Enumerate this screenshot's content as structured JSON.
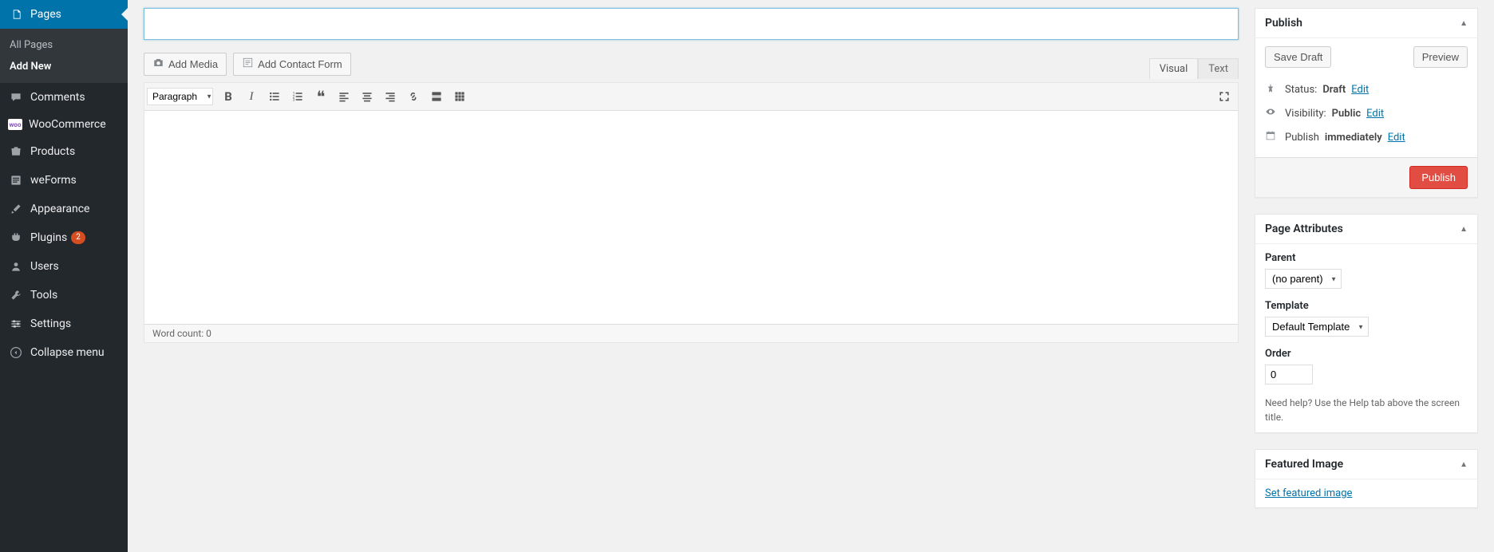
{
  "sidebar": {
    "items": [
      {
        "label": "Pages",
        "icon": "📄",
        "current": true,
        "submenu": [
          {
            "label": "All Pages"
          },
          {
            "label": "Add New",
            "current": true
          }
        ]
      },
      {
        "label": "Comments",
        "icon": "💬"
      },
      {
        "label": "WooCommerce",
        "icon": "woo"
      },
      {
        "label": "Products",
        "icon": "📦"
      },
      {
        "label": "weForms",
        "icon": "📋"
      },
      {
        "label": "Appearance",
        "icon": "🖌"
      },
      {
        "label": "Plugins",
        "icon": "🔌",
        "badge": "2"
      },
      {
        "label": "Users",
        "icon": "👤"
      },
      {
        "label": "Tools",
        "icon": "🔧"
      },
      {
        "label": "Settings",
        "icon": "⚙"
      },
      {
        "label": "Collapse menu",
        "icon": "◀"
      }
    ]
  },
  "title_value": "",
  "media": {
    "add_media": "Add Media",
    "add_contact_form": "Add Contact Form"
  },
  "tabs": {
    "visual": "Visual",
    "text": "Text"
  },
  "toolbar": {
    "format_label": "Paragraph"
  },
  "status_bar": {
    "word_count_label": "Word count: 0"
  },
  "publish": {
    "title": "Publish",
    "save_draft": "Save Draft",
    "preview": "Preview",
    "status_label": "Status:",
    "status_value": "Draft",
    "visibility_label": "Visibility:",
    "visibility_value": "Public",
    "publish_label": "Publish",
    "publish_value": "immediately",
    "edit": "Edit",
    "publish_button": "Publish"
  },
  "page_attributes": {
    "title": "Page Attributes",
    "parent_label": "Parent",
    "parent_value": "(no parent)",
    "template_label": "Template",
    "template_value": "Default Template",
    "order_label": "Order",
    "order_value": "0",
    "help_text": "Need help? Use the Help tab above the screen title."
  },
  "featured_image": {
    "title": "Featured Image",
    "set_link": "Set featured image"
  }
}
